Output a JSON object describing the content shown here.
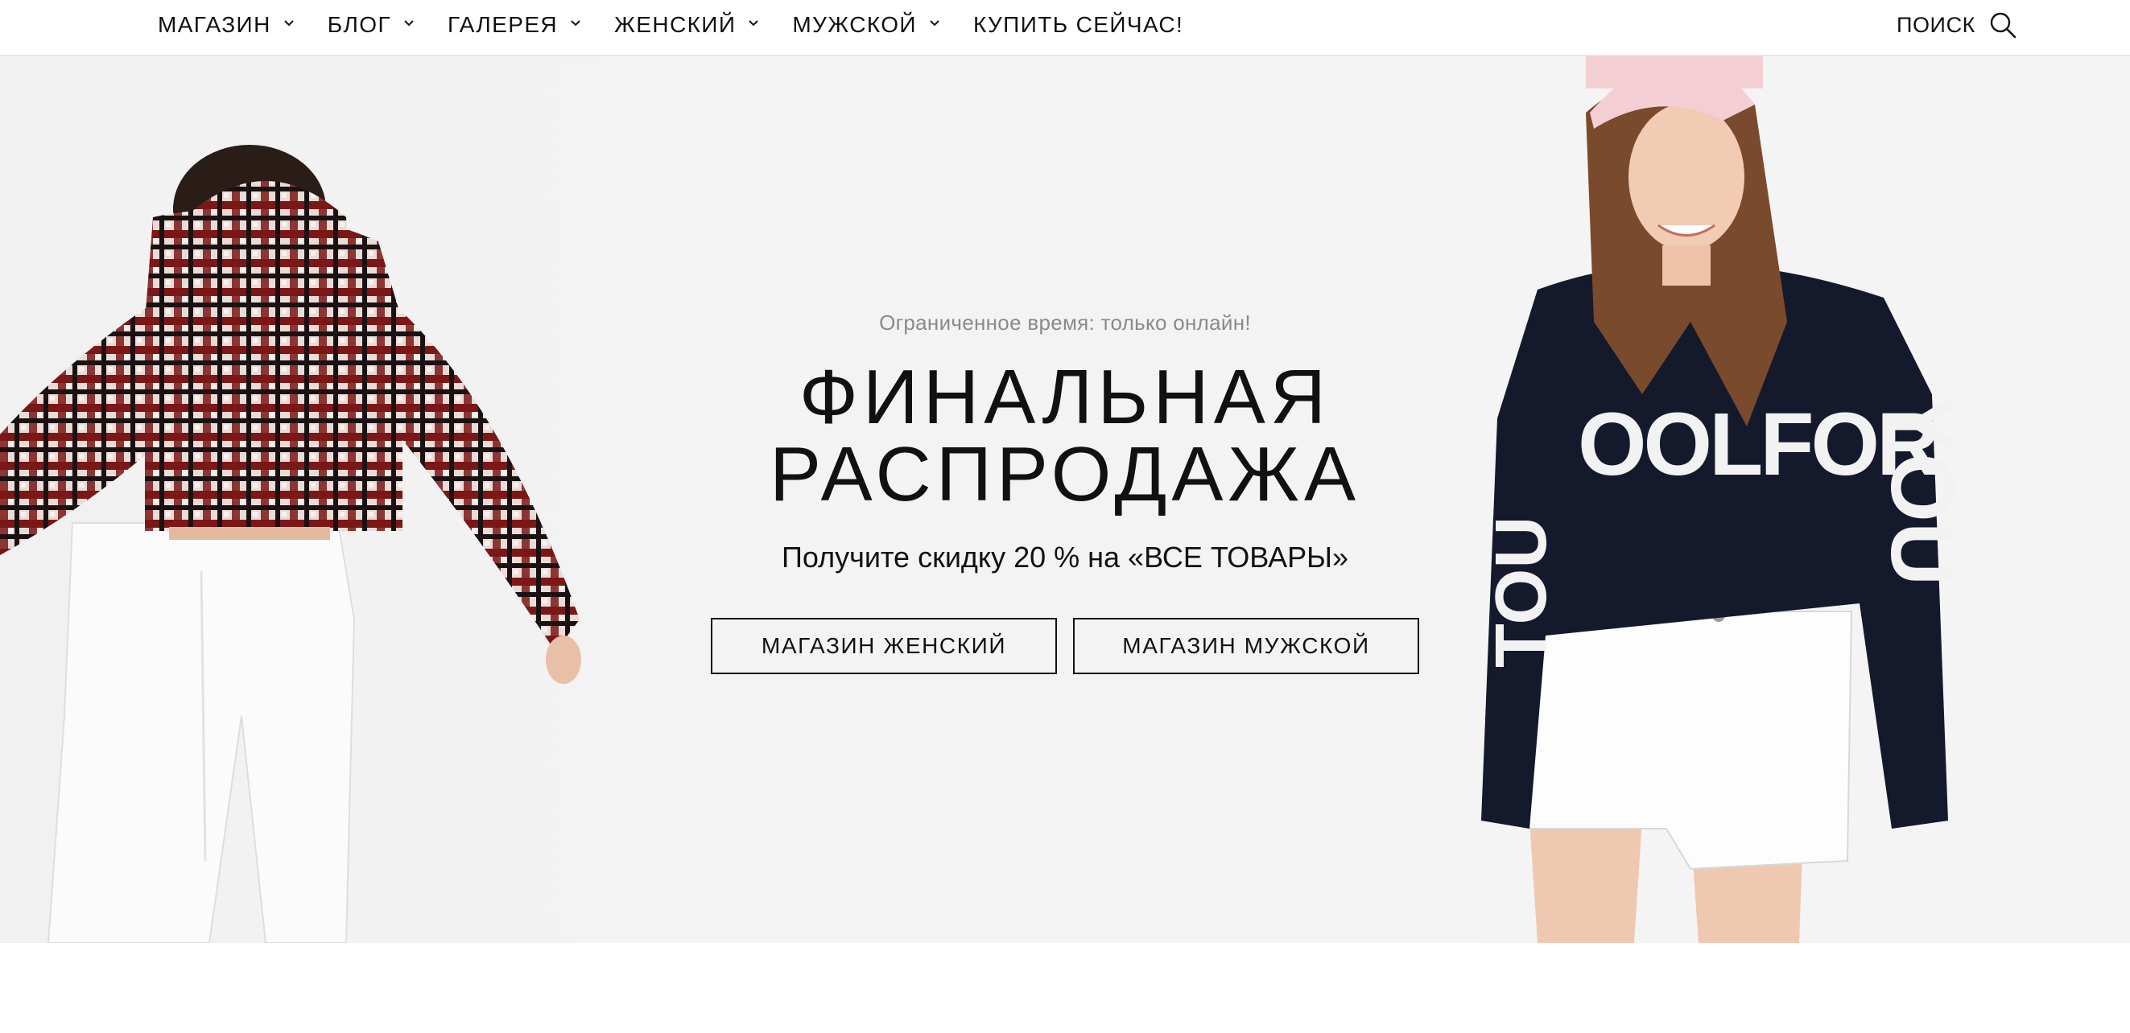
{
  "nav": {
    "items": [
      {
        "label": "МАГАЗИН",
        "has_dropdown": true,
        "icon": "chevron-down-icon"
      },
      {
        "label": "БЛОГ",
        "has_dropdown": true,
        "icon": "chevron-down-icon"
      },
      {
        "label": "ГАЛЕРЕЯ",
        "has_dropdown": true,
        "icon": "chevron-down-icon"
      },
      {
        "label": "ЖЕНСКИЙ",
        "has_dropdown": true,
        "icon": "chevron-down-icon"
      },
      {
        "label": "МУЖСКОЙ",
        "has_dropdown": true,
        "icon": "chevron-down-icon"
      },
      {
        "label": "КУПИТЬ СЕЙЧАС!",
        "has_dropdown": false
      }
    ],
    "search_label": "ПОИСК",
    "search_icon": "search-icon"
  },
  "hero": {
    "eyebrow": "Ограниченное время: только онлайн!",
    "headline_line1": "ФИНАЛЬНАЯ",
    "headline_line2": "РАСПРОДАЖА",
    "subline": "Получите скидку 20 % на «ВСЕ ТОВАРЫ»",
    "cta_women": "МАГАЗИН ЖЕНСКИЙ",
    "cta_men": "МАГАЗИН МУЖСКОЙ",
    "left_image": "woman-in-plaid-hoodie-photo",
    "right_image": "woman-in-cap-and-sweater-photo"
  },
  "colors": {
    "hero_bg": "#f3f3f3",
    "text": "#111111",
    "muted": "#8a8a8a"
  }
}
